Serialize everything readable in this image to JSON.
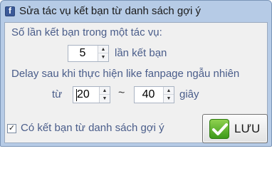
{
  "window": {
    "title": "Sửa tác vụ kết bạn từ danh sách gợi ý",
    "icon": "facebook-icon"
  },
  "form": {
    "label_count": "Số lần kết bạn trong một tác vụ:",
    "count_value": "5",
    "count_unit": "lần kết bạn",
    "label_delay": "Delay sau khi thực hiện like fanpage ngẫu nhiên",
    "from_label": "từ",
    "delay_from": "20",
    "range_separator": "~",
    "delay_to": "40",
    "delay_unit": "giây"
  },
  "checkbox": {
    "label": "Có kết bạn từ danh sách gợi ý",
    "checked": true,
    "mark": "✓"
  },
  "save_button": {
    "label": "LƯU",
    "icon": "check-icon"
  },
  "spinner_arrows": {
    "up": "▲",
    "down": "▼"
  },
  "colors": {
    "title_bar": "#b6cbe6",
    "client_bg": "#f0f0f0",
    "label_text": "#4a5d8a",
    "check_green": "#3d9a1b"
  }
}
